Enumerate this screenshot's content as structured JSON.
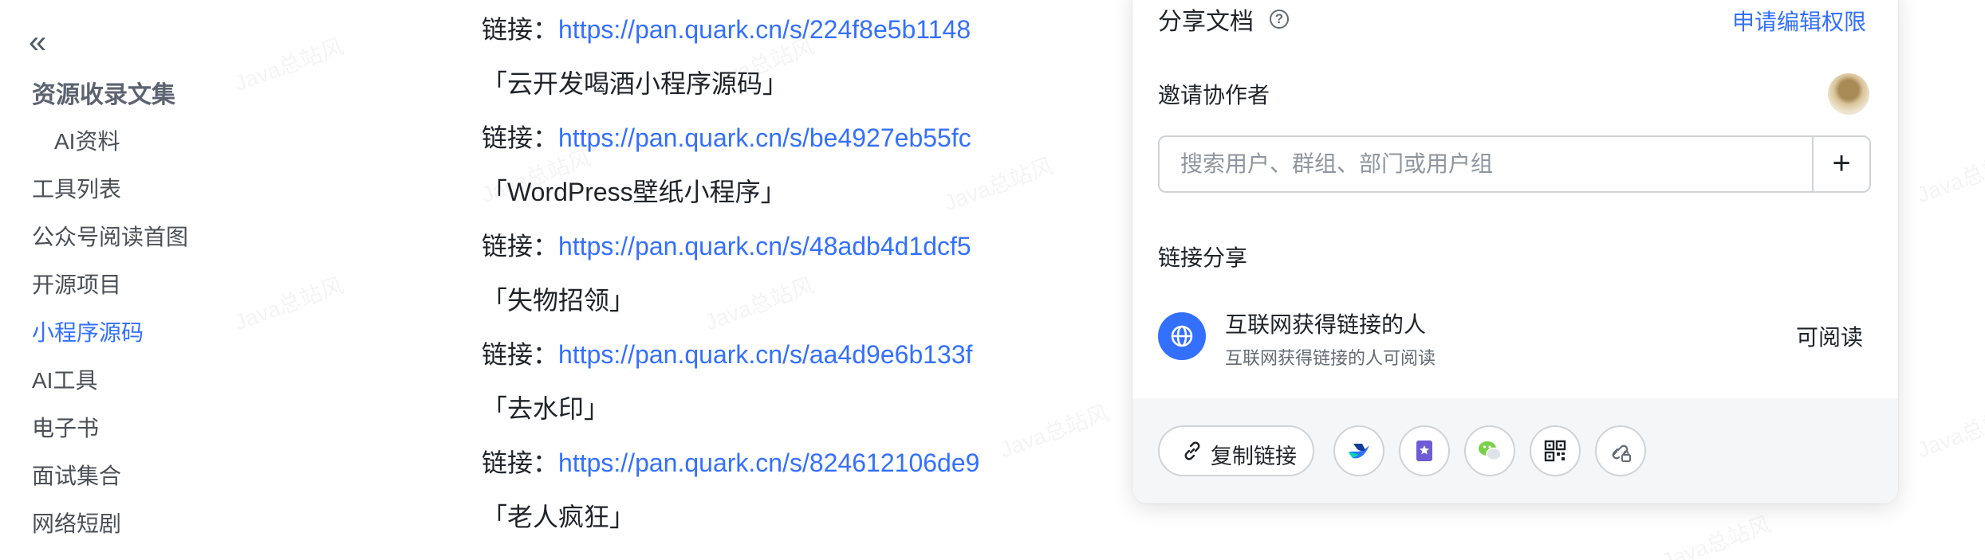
{
  "watermark": "Java总站风",
  "sidebar": {
    "collapse_glyph": "«",
    "title": "资源收录文集",
    "items": [
      {
        "label": "AI资料"
      },
      {
        "label": "工具列表"
      },
      {
        "label": "公众号阅读首图"
      },
      {
        "label": "开源项目"
      },
      {
        "label": "小程序源码",
        "active": true
      },
      {
        "label": "AI工具"
      },
      {
        "label": "电子书"
      },
      {
        "label": "面试集合"
      },
      {
        "label": "网络短剧"
      }
    ]
  },
  "content": {
    "link_prefix": "链接：",
    "lines": [
      {
        "type": "link",
        "url": "https://pan.quark.cn/s/224f8e5b1148"
      },
      {
        "type": "title",
        "text": "「云开发喝酒小程序源码」"
      },
      {
        "type": "link",
        "url": "https://pan.quark.cn/s/be4927eb55fc"
      },
      {
        "type": "title",
        "text": "「WordPress壁纸小程序」"
      },
      {
        "type": "link",
        "url": "https://pan.quark.cn/s/48adb4d1dcf5"
      },
      {
        "type": "title",
        "text": "「失物招领」"
      },
      {
        "type": "link",
        "url": "https://pan.quark.cn/s/aa4d9e6b133f"
      },
      {
        "type": "title",
        "text": "「去水印」"
      },
      {
        "type": "link",
        "url": "https://pan.quark.cn/s/824612106de9"
      },
      {
        "type": "title",
        "text": "「老人疯狂」"
      }
    ]
  },
  "share_panel": {
    "title": "分享文档",
    "help_glyph": "?",
    "request_edit_label": "申请编辑权限",
    "invite_label": "邀请协作者",
    "search_placeholder": "搜索用户、群组、部门或用户组",
    "add_glyph": "+",
    "link_share_label": "链接分享",
    "link_scope_title": "互联网获得链接的人",
    "link_scope_desc": "互联网获得链接的人可阅读",
    "permission_label": "可阅读",
    "copy_link_label": "复制链接",
    "share_icons": [
      "lark-icon",
      "bookmark-icon",
      "wechat-icon",
      "qrcode-icon",
      "link-lock-icon"
    ],
    "colors": {
      "accent": "#3370ff",
      "footer_bg": "#f5f6f7",
      "wechat": "#7bd04a",
      "bookmark": "#6e5bd6"
    }
  }
}
